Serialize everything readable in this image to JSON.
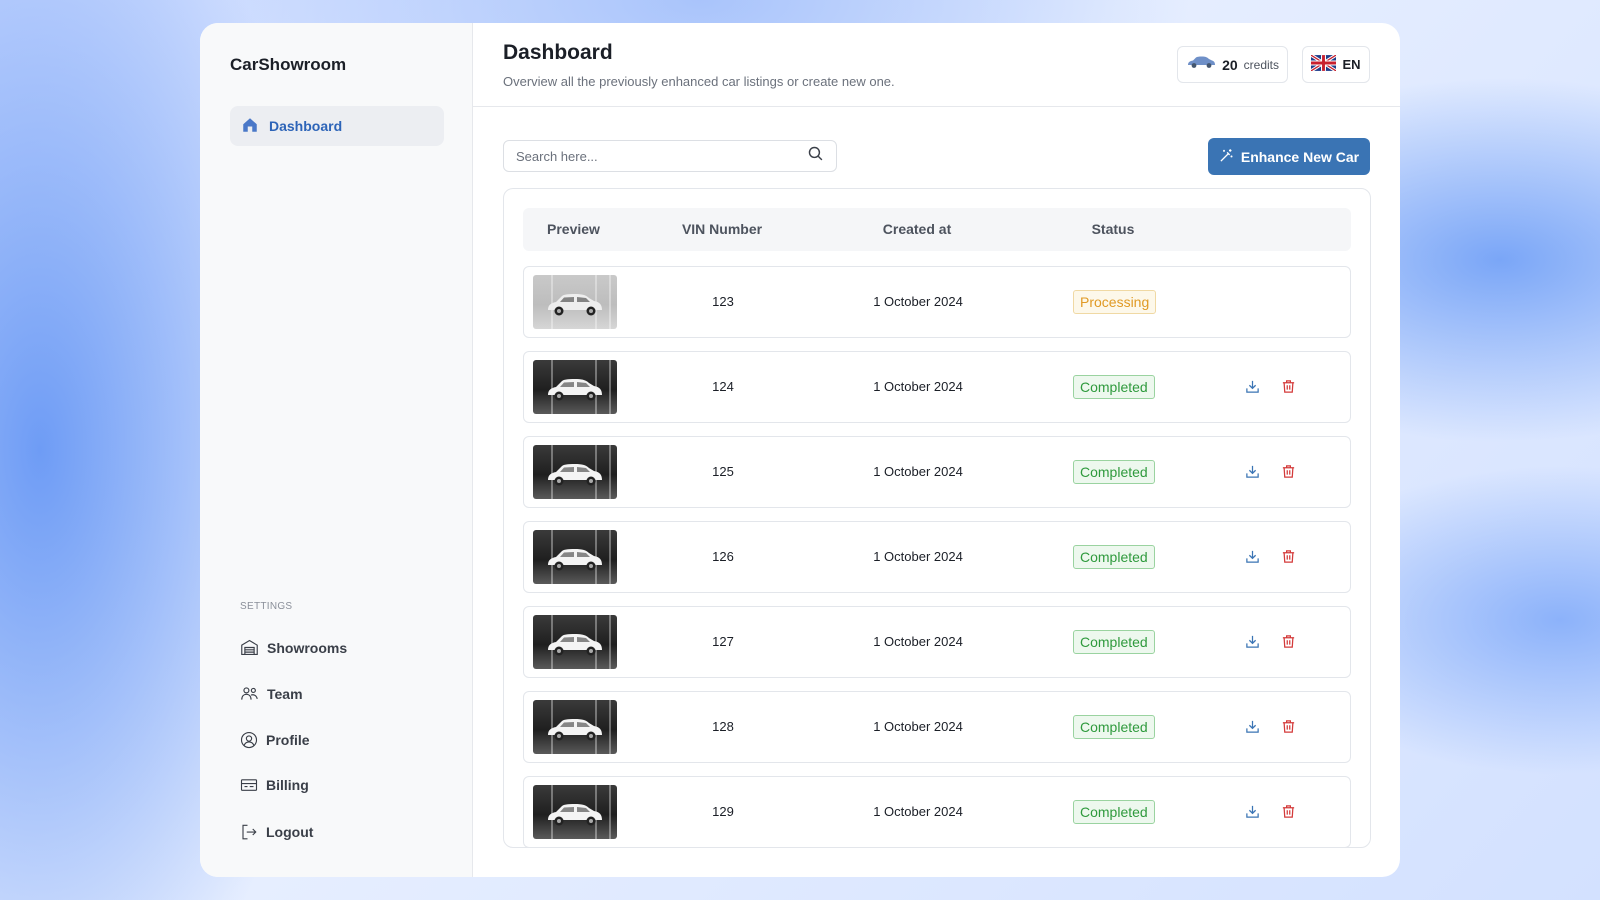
{
  "app": {
    "brand": "CarShowroom"
  },
  "sidebar": {
    "active_item": {
      "label": "Dashboard",
      "icon": "home-icon"
    },
    "settings_label": "SETTINGS",
    "items": [
      {
        "label": "Showrooms",
        "icon": "garage-icon"
      },
      {
        "label": "Team",
        "icon": "team-icon"
      },
      {
        "label": "Profile",
        "icon": "profile-icon"
      },
      {
        "label": "Billing",
        "icon": "billing-icon"
      },
      {
        "label": "Logout",
        "icon": "logout-icon"
      }
    ]
  },
  "header": {
    "title": "Dashboard",
    "subtitle": "Overview all the previously enhanced car listings or create new one.",
    "credits_value": "20",
    "credits_label": "credits",
    "language": "EN"
  },
  "toolbar": {
    "search_placeholder": "Search here...",
    "enhance_label": "Enhance New Car"
  },
  "table": {
    "columns": [
      "Preview",
      "VIN Number",
      "Created at",
      "Status"
    ],
    "rows": [
      {
        "vin": "123",
        "created": "1 October 2024",
        "status": "Processing"
      },
      {
        "vin": "124",
        "created": "1 October 2024",
        "status": "Completed"
      },
      {
        "vin": "125",
        "created": "1 October 2024",
        "status": "Completed"
      },
      {
        "vin": "126",
        "created": "1 October 2024",
        "status": "Completed"
      },
      {
        "vin": "127",
        "created": "1 October 2024",
        "status": "Completed"
      },
      {
        "vin": "128",
        "created": "1 October 2024",
        "status": "Completed"
      },
      {
        "vin": "129",
        "created": "1 October 2024",
        "status": "Completed"
      }
    ]
  },
  "colors": {
    "accent": "#3a74b4",
    "active_nav_text": "#2d64b8",
    "processing": "#e09a25",
    "completed": "#2f9a3d",
    "delete": "#d43a3a",
    "download": "#3a74b4"
  }
}
